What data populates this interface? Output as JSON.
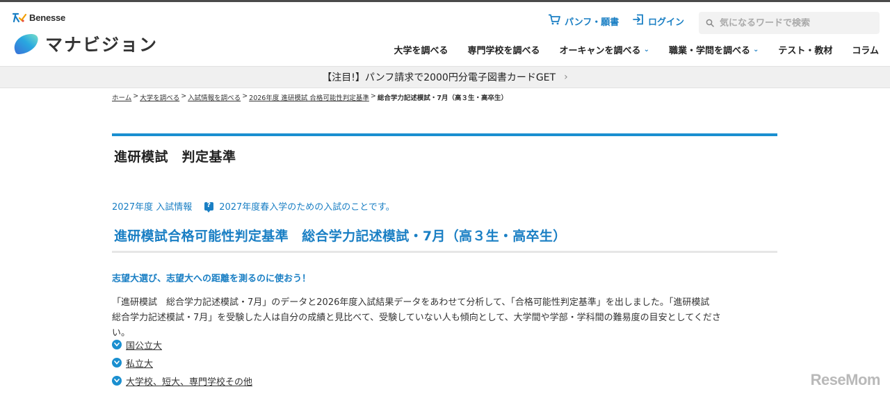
{
  "header": {
    "benesse": "Benesse",
    "logo_text": "マナビジョン",
    "pamphlet_label": "パンフ・願書",
    "login_label": "ログイン",
    "search_placeholder": "気になるワードで検索",
    "nav": [
      {
        "label": "大学を調べる",
        "dropdown": false
      },
      {
        "label": "専門学校を調べる",
        "dropdown": false
      },
      {
        "label": "オーキャンを調べる",
        "dropdown": true
      },
      {
        "label": "職業・学問を調べる",
        "dropdown": true
      },
      {
        "label": "テスト・教材",
        "dropdown": false
      },
      {
        "label": "コラム",
        "dropdown": false
      }
    ]
  },
  "banner": {
    "text": "【注目!】パンフ請求で2000円分電子図書カードGET",
    "arrow": "›"
  },
  "breadcrumb": {
    "items": [
      "ホーム",
      "大学を調べる",
      "入試情報を調べる",
      "2026年度 進研模試 合格可能性判定基準"
    ],
    "current": "総合学力記述模試・7月（高３生・高卒生）"
  },
  "section_title": "進研模試　判定基準",
  "info": {
    "year_label": "2027年度 入試情報",
    "note": "2027年度春入学のための入試のことです。"
  },
  "main_title": "進研模試合格可能性判定基準　総合学力記述模試・7月（高３生・高卒生）",
  "lead": "志望大選び、志望大への距離を測るのに使おう！",
  "description": "「進研模試　総合学力記述模試・7月」のデータと2026年度入試結果データをあわせて分析して、「合格可能性判定基準」を出しました。「進研模試　総合学力記述模試・7月」を受験した人は自分の成績と見比べて、受験していない人も傾向として、大学間や学部・学科間の難易度の目安としてください。",
  "links": [
    "国公立大",
    "私立大",
    "大学校、短大、専門学校その他"
  ],
  "watermark": "ReseMom",
  "colors": {
    "accent": "#1a7fc4",
    "bar": "#1a8fd0"
  }
}
